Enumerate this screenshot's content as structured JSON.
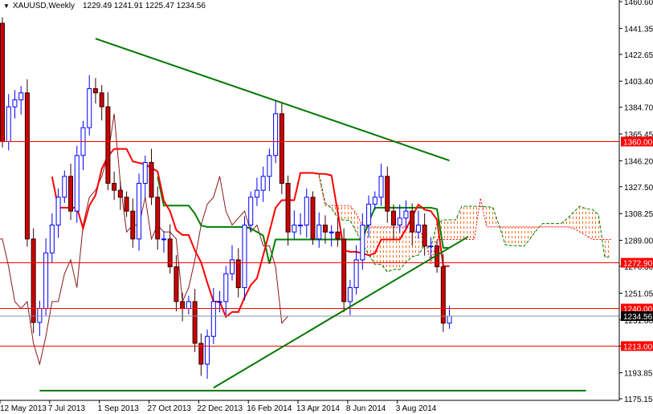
{
  "header": {
    "arrow": "▼",
    "symbol": "XAUUSD,Weekly",
    "ohlc": "1229.49 1241.91 1225.47 1234.56"
  },
  "chart_data": {
    "type": "candlestick",
    "symbol": "XAUUSD",
    "timeframe": "Weekly",
    "ylim": [
      1175.15,
      1460.6
    ],
    "y_ticks": [
      "1460.60",
      "1441.35",
      "1422.65",
      "1403.40",
      "1384.70",
      "1365.45",
      "1346.20",
      "1327.50",
      "1308.25",
      "1289.00",
      "1270.30",
      "1251.05",
      "1231.80",
      "1213.00",
      "1193.85",
      "1175.15"
    ],
    "x_labels": [
      "12 May 2013",
      "7 Jul 2013",
      "1 Sep 2013",
      "27 Oct 2013",
      "22 Dec 2013",
      "16 Feb 2014",
      "13 Apr 2014",
      "8 Jun 2014",
      "3 Aug 2014"
    ],
    "x_label_every_weeks": 8,
    "first_open": 1445,
    "wick": 7,
    "closes": [
      1360,
      1385,
      1390,
      1395,
      1290,
      1230,
      1240,
      1280,
      1300,
      1320,
      1335,
      1310,
      1350,
      1370,
      1398,
      1395,
      1385,
      1330,
      1325,
      1320,
      1310,
      1290,
      1330,
      1345,
      1320,
      1290,
      1290,
      1270,
      1245,
      1240,
      1245,
      1215,
      1200,
      1220,
      1245,
      1245,
      1265,
      1275,
      1255,
      1300,
      1320,
      1325,
      1335,
      1350,
      1380,
      1330,
      1295,
      1300,
      1300,
      1320,
      1290,
      1300,
      1295,
      1295,
      1290,
      1245,
      1255,
      1275,
      1300,
      1315,
      1320,
      1335,
      1310,
      1300,
      1305,
      1310,
      1295,
      1300,
      1285,
      1285,
      1270,
      1229.49,
      1234.56
    ],
    "last_candle": {
      "open": 1229.49,
      "high": 1241.91,
      "low": 1225.47,
      "close": 1234.56
    },
    "indicator": {
      "name": "Ichimoku",
      "tenkan": 9,
      "kijun": 26,
      "senkou_b": 52
    },
    "horizontal_levels": [
      {
        "price": 1360.0,
        "label": "1360.00",
        "color": "#ff0000"
      },
      {
        "price": 1272.9,
        "label": "1272.90",
        "color": "#ff0000"
      },
      {
        "price": 1240.0,
        "label": "1240.00",
        "color": "#ff0000"
      },
      {
        "price": 1213.0,
        "label": "1213.00",
        "color": "#ff0000"
      }
    ],
    "current_price": {
      "price": 1234.56,
      "label": "1234.56",
      "color": "#000000"
    },
    "trendlines": [
      {
        "from": {
          "week": 15,
          "price": 1434
        },
        "to": {
          "week": 72,
          "price": 1346.4
        },
        "color": "#007700"
      },
      {
        "from": {
          "week": 34,
          "price": 1183
        },
        "to": {
          "week": 75,
          "price": 1291.6
        },
        "color": "#007700"
      },
      {
        "from": {
          "week": 6,
          "price": 1181
        },
        "to": {
          "week": 94,
          "price": 1181
        },
        "color": "#007700"
      }
    ],
    "colors": {
      "bull_body": "#ffffff",
      "bull_line": "#0000ff",
      "bear_body": "#cc0000",
      "bear_line": "#330000",
      "tenkan": "#ff0000",
      "kijun": "#008000",
      "chikou": "#8b1a1a",
      "cloud": "#ff6a1a",
      "span_a": "#008000",
      "span_b": "#ff0000"
    }
  }
}
